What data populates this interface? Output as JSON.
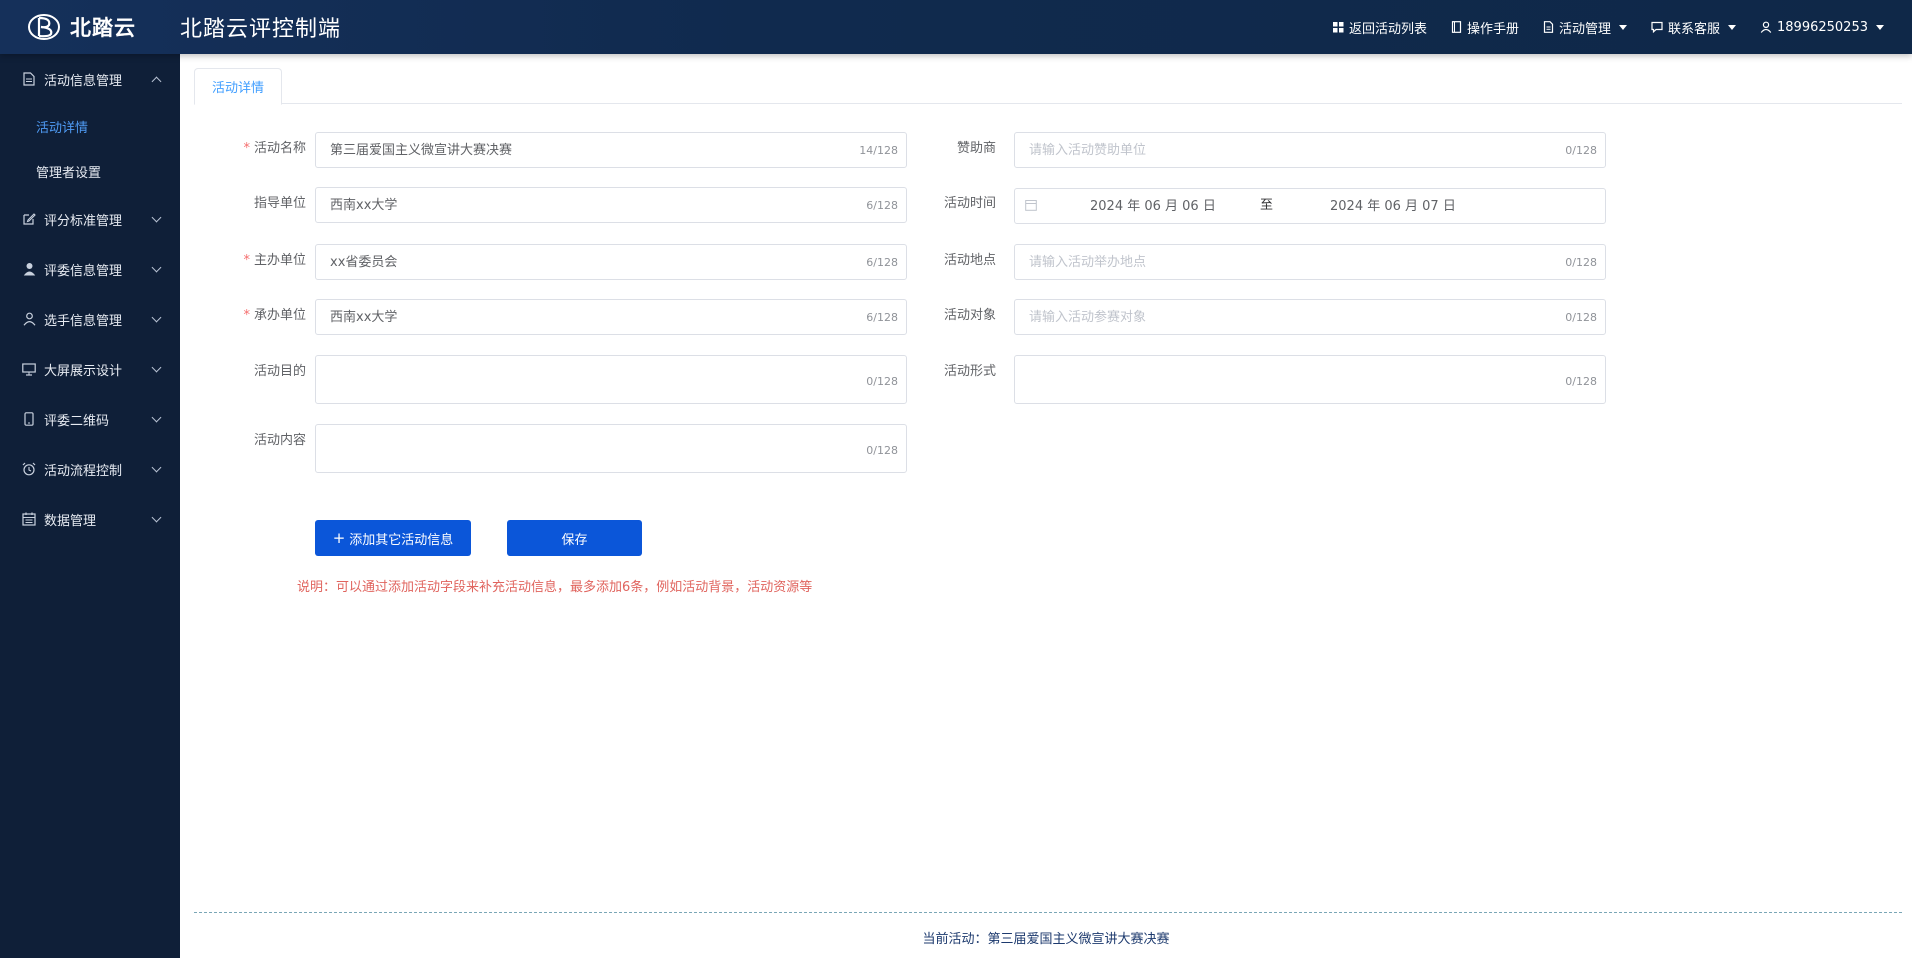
{
  "header": {
    "logo_text": "北踏云",
    "app_title": "北踏云评控制端",
    "nav": {
      "back": "返回活动列表",
      "manual": "操作手册",
      "activity_manage": "活动管理",
      "support": "联系客服",
      "user": "18996250253"
    }
  },
  "sidebar": {
    "items": [
      {
        "label": "活动信息管理",
        "icon": "document-icon",
        "expanded": true,
        "children": [
          {
            "label": "活动详情",
            "active": true
          },
          {
            "label": "管理者设置"
          }
        ]
      },
      {
        "label": "评分标准管理",
        "icon": "edit-icon"
      },
      {
        "label": "评委信息管理",
        "icon": "user-filled-icon"
      },
      {
        "label": "选手信息管理",
        "icon": "user-outline-icon"
      },
      {
        "label": "大屏展示设计",
        "icon": "monitor-icon"
      },
      {
        "label": "评委二维码",
        "icon": "mobile-icon"
      },
      {
        "label": "活动流程控制",
        "icon": "alarm-icon"
      },
      {
        "label": "数据管理",
        "icon": "calendar-icon"
      }
    ]
  },
  "tab": {
    "label": "活动详情"
  },
  "form": {
    "name": {
      "label": "活动名称",
      "required": true,
      "value": "第三届爱国主义微宣讲大赛决赛",
      "count": "14/128"
    },
    "sponsor": {
      "label": "赞助商",
      "placeholder": "请输入活动赞助单位",
      "count": "0/128"
    },
    "guide": {
      "label": "指导单位",
      "value": "西南xx大学",
      "count": "6/128"
    },
    "time": {
      "label": "活动时间",
      "start": "2024 年 06 月 06 日",
      "sep": "至",
      "end": "2024 年 06 月 07 日"
    },
    "host": {
      "label": "主办单位",
      "required": true,
      "value": "xx省委员会",
      "count": "6/128"
    },
    "location": {
      "label": "活动地点",
      "placeholder": "请输入活动举办地点",
      "count": "0/128"
    },
    "organizer": {
      "label": "承办单位",
      "required": true,
      "value": "西南xx大学",
      "count": "6/128"
    },
    "audience": {
      "label": "活动对象",
      "placeholder": "请输入活动参赛对象",
      "count": "0/128"
    },
    "purpose": {
      "label": "活动目的",
      "count": "0/128"
    },
    "form_type": {
      "label": "活动形式",
      "count": "0/128"
    },
    "content": {
      "label": "活动内容",
      "count": "0/128"
    }
  },
  "buttons": {
    "add": "添加其它活动信息",
    "save": "保存"
  },
  "note": "说明：可以通过添加活动字段来补充活动信息，最多添加6条，例如活动背景，活动资源等",
  "footer": {
    "current": "当前活动：第三届爱国主义微宣讲大赛决赛"
  },
  "colors": {
    "header_bg": "#102a4e",
    "sidebar_bg": "#0f1f38",
    "accent": "#409eff",
    "button": "#0b56d9",
    "note": "#e0645e"
  }
}
